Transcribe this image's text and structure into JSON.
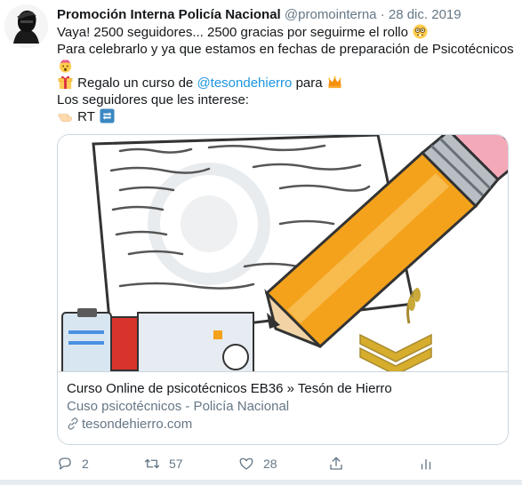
{
  "tweet": {
    "author_name": "Promoción Interna Policía Nacional",
    "handle": "@promointerna",
    "separator": "·",
    "date": "28 dic. 2019",
    "lines": {
      "l1": "Vaya! 2500 seguidores... 2500 gracias por seguirme el rollo",
      "l2": "Para celebrarlo y ya que estamos en fechas de preparación de Psicotécnicos",
      "l4_pre": "Regalo un curso de",
      "l4_mention": "@tesondehierro",
      "l4_post": "para",
      "l5": "Los seguidores que les interese:",
      "l6": "RT"
    }
  },
  "card": {
    "title": "Curso Online de psicotécnicos EB36 » Tesón de Hierro",
    "description": "Cuso psicotécnicos - Policía Nacional",
    "domain": "tesondehierro.com"
  },
  "actions": {
    "reply_count": "2",
    "retweet_count": "57",
    "like_count": "28"
  },
  "icons": {
    "avatar": "masked-figure-avatar",
    "emoji_1": "nerd-face-emoji",
    "emoji_2": "exploding-head-emoji",
    "emoji_3": "gift-emoji",
    "emoji_4": "crown-emoji",
    "emoji_5": "pointing-hand-emoji",
    "emoji_6": "repeat-emoji",
    "reply": "reply-icon",
    "retweet": "retweet-icon",
    "like": "heart-icon",
    "share": "share-icon",
    "analytics": "analytics-icon"
  },
  "colors": {
    "link": "#1b95e0",
    "text": "#14171a",
    "muted": "#657786",
    "pencil": "#f4a21b",
    "eraser": "#f4a9b8"
  }
}
